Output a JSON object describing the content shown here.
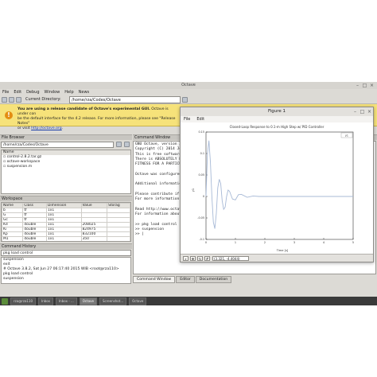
{
  "window": {
    "title": "Octave"
  },
  "menu": [
    {
      "label": "File"
    },
    {
      "label": "Edit"
    },
    {
      "label": "Debug"
    },
    {
      "label": "Window"
    },
    {
      "label": "Help"
    },
    {
      "label": "News"
    }
  ],
  "toolbar": {
    "dir_label": "Current Directory:",
    "dir_value": "/home/rza/Codes/Octave"
  },
  "banner": {
    "bold": "You are using a release candidate of Octave's experimental GUI.",
    "line1": " Octave is under con",
    "line2": "be the default interface for the 4.2 release. For more information, please see \"Release Notes\"",
    "line3_pre": "or visit ",
    "line3_link": "http://octave.org",
    "line3_post": "."
  },
  "file_browser": {
    "title": "File Browser",
    "path": "/home/rza/Codes/Octave",
    "header": "Name",
    "items": [
      {
        "name": "control-2.8.2.tar.gz"
      },
      {
        "name": "octave-workspace"
      },
      {
        "name": "suspension.m"
      }
    ]
  },
  "workspace": {
    "title": "Workspace",
    "columns": [
      "Name",
      "Class",
      "Dimension",
      "Value",
      "Storag"
    ],
    "rows": [
      [
        "b",
        "tf",
        "1x1",
        "",
        ""
      ],
      [
        "G",
        "tf",
        "1x1",
        "",
        ""
      ],
      [
        "Gc",
        "tf",
        "1x1",
        "",
        ""
      ],
      [
        "Kd",
        "double",
        "1x1",
        "208025",
        ""
      ],
      [
        "Ki",
        "double",
        "1x1",
        "824975",
        ""
      ],
      [
        "Kp",
        "double",
        "1x1",
        "832100",
        ""
      ],
      [
        "M1",
        "double",
        "1x1",
        "350",
        ""
      ],
      [
        "M2",
        "double",
        "1x1",
        "",
        ""
      ]
    ]
  },
  "history": {
    "title": "Command History",
    "filter_value": "pkg load control",
    "lines": [
      "suspension",
      "exit",
      "# Octave 3.8.2, Sat Jun 27 06:17:40 2015 WIB <root@rza110>",
      "pkg load control",
      "suspension"
    ]
  },
  "command_window": {
    "title": "Command Window",
    "lines": [
      "GNU Octave, version 3",
      "Copyright (C) 2014 Joh",
      "This is free software",
      "There is ABSOLUTELY NO",
      "FITNESS FOR A PARTICUL",
      "",
      "Octave was configured",
      "",
      "Additional information",
      "",
      "Please contribute if y",
      "For more information,",
      "",
      "Read http://www.octave",
      "For information about",
      "",
      ">> pkg load control",
      ">> suspension",
      ">> |"
    ],
    "tabs": [
      "Command Window",
      "Editor",
      "Documentation"
    ]
  },
  "figure": {
    "title": "Figure 1",
    "menu": [
      "File",
      "Edit"
    ],
    "coord_readout": "(3.321, -4.4044)",
    "legend_text": "y1"
  },
  "chart_data": {
    "type": "line",
    "title": "Closed-Loop Response to 0.1-m High Step w/ PID Controller",
    "xlabel": "Time [s]",
    "ylabel": "y1",
    "xlim": [
      0,
      5
    ],
    "ylim": [
      -0.1,
      0.15
    ],
    "x_ticks": [
      "0",
      "1",
      "2",
      "3",
      "4",
      "5"
    ],
    "y_ticks": [
      "0.15",
      "0.1",
      "0.05",
      "0",
      "-0.05",
      "-0.1"
    ],
    "series": [
      {
        "color": "#a7b9d6",
        "x": [
          0,
          0.05,
          0.1,
          0.15,
          0.2,
          0.25,
          0.3,
          0.35,
          0.4,
          0.45,
          0.5,
          0.55,
          0.6,
          0.65,
          0.7,
          0.75,
          0.8,
          0.9,
          1.0,
          1.1,
          1.2,
          1.4,
          1.6,
          1.8,
          2.0,
          2.5,
          3.0,
          4.0,
          5.0
        ],
        "y": [
          0,
          0.1,
          0.13,
          0.08,
          0.0,
          -0.06,
          -0.075,
          -0.04,
          0.02,
          0.04,
          0.03,
          -0.01,
          -0.03,
          -0.025,
          0.0,
          0.015,
          0.012,
          -0.006,
          -0.008,
          0.004,
          0.005,
          -0.002,
          0.001,
          0.0,
          0.0,
          0.0,
          0.0,
          0.0,
          0.0
        ]
      }
    ]
  },
  "taskbar": [
    {
      "label": "rza@rza110"
    },
    {
      "label": "Inbox"
    },
    {
      "label": "Inbox - ..."
    },
    {
      "label": "Octave"
    },
    {
      "label": "Screenshot..."
    },
    {
      "label": "Octave"
    }
  ]
}
